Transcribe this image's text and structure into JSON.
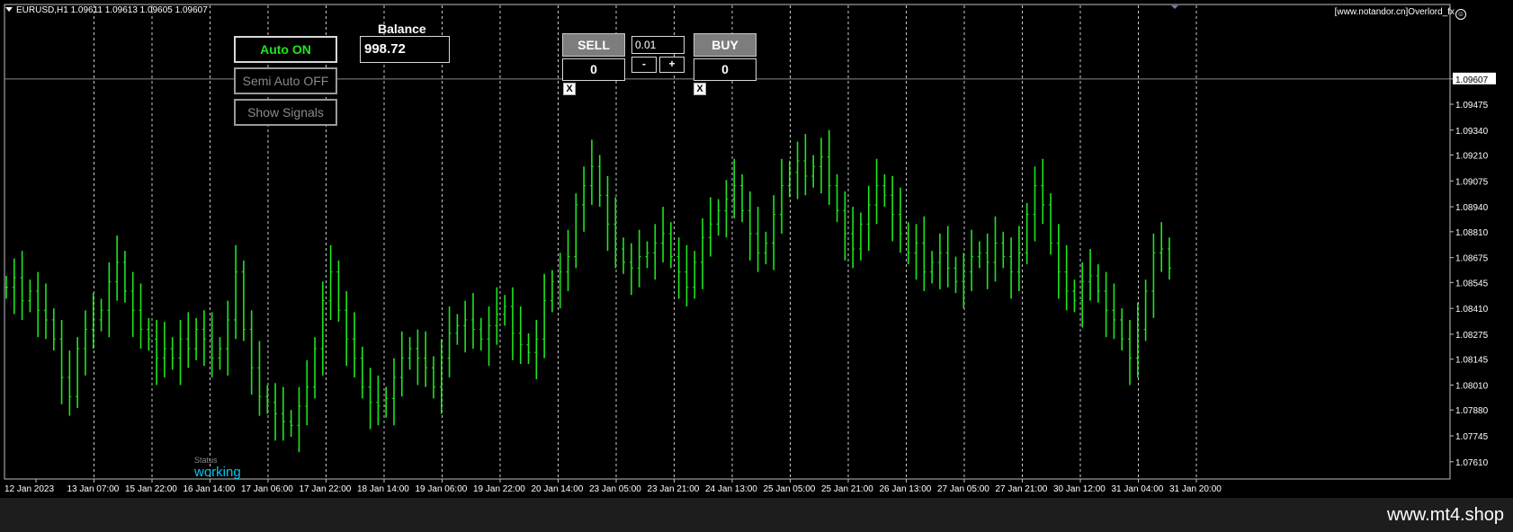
{
  "header": {
    "symbol_info": "EURUSD,H1  1.09611 1.09613 1.09605 1.09607",
    "brand": "[www.notandor.cn]Overlord_fx"
  },
  "panel": {
    "auto_label": "Auto ON",
    "semi_label": "Semi Auto OFF",
    "signals_label": "Show Signals",
    "balance_title": "Balance",
    "balance_value": "998.72"
  },
  "trade": {
    "sell_label": "SELL",
    "buy_label": "BUY",
    "lot_value": "0.01",
    "sell_count": "0",
    "buy_count": "0",
    "minus_label": "-",
    "plus_label": "+",
    "close_mark": "X"
  },
  "status": {
    "label": "Status",
    "value": "working"
  },
  "watermark": "www.mt4.shop",
  "colors": {
    "candles": "#1ee51e",
    "background": "#000000",
    "grid_vline": "#c8c8c8",
    "status": "#00c8f0"
  },
  "chart_data": {
    "type": "line",
    "symbol": "EURUSD",
    "timeframe": "H1",
    "current_price": "1.09607",
    "ylim": [
      1.0752,
      1.0985
    ],
    "y_ticks": [
      "1.09607",
      "1.09475",
      "1.09340",
      "1.09210",
      "1.09075",
      "1.08940",
      "1.08810",
      "1.08675",
      "1.08545",
      "1.08410",
      "1.08275",
      "1.08145",
      "1.08010",
      "1.07880",
      "1.07745",
      "1.07610"
    ],
    "x_tick_labels": [
      "12 Jan 2023",
      "13 Jan 07:00",
      "15 Jan 22:00",
      "16 Jan 14:00",
      "17 Jan 06:00",
      "17 Jan 22:00",
      "18 Jan 14:00",
      "19 Jan 06:00",
      "19 Jan 22:00",
      "20 Jan 14:00",
      "23 Jan 05:00",
      "23 Jan 21:00",
      "24 Jan 13:00",
      "25 Jan 05:00",
      "25 Jan 21:00",
      "26 Jan 13:00",
      "27 Jan 05:00",
      "27 Jan 21:00",
      "30 Jan 12:00",
      "31 Jan 04:00",
      "31 Jan 20:00"
    ],
    "vline_positions": [
      1,
      2,
      3,
      4,
      5,
      6,
      7,
      8,
      9,
      10,
      11,
      12,
      13,
      14,
      15,
      16,
      17,
      18,
      19,
      20
    ],
    "series": [
      {
        "values": [
          1.0852,
          1.0857,
          1.0845,
          1.085,
          1.084,
          1.0835,
          1.0825,
          1.0805,
          1.0795,
          1.082,
          1.083,
          1.0835,
          1.084,
          1.0855,
          1.0865,
          1.085,
          1.084,
          1.083,
          1.0825,
          1.0815,
          1.082,
          1.0815,
          1.0825,
          1.082,
          1.083,
          1.0825,
          1.0815,
          1.082,
          1.0835,
          1.086,
          1.083,
          1.081,
          1.0795,
          1.0792,
          1.0786,
          1.0782,
          1.078,
          1.079,
          1.08,
          1.082,
          1.0845,
          1.086,
          1.084,
          1.0825,
          1.0815,
          1.08,
          1.0792,
          1.079,
          1.0794,
          1.0805,
          1.0815,
          1.082,
          1.0815,
          1.081,
          1.08,
          1.0815,
          1.0828,
          1.0832,
          1.0835,
          1.083,
          1.0825,
          1.0832,
          1.0838,
          1.0842,
          1.0828,
          1.0822,
          1.0818,
          1.0825,
          1.0845,
          1.0855,
          1.086,
          1.0868,
          1.0895,
          1.0905,
          1.0915,
          1.09,
          1.0885,
          1.0872,
          1.0865,
          1.0862,
          1.0868,
          1.087,
          1.0875,
          1.088,
          1.0868,
          1.086,
          1.0852,
          1.0865,
          1.0878,
          1.0885,
          1.0892,
          1.0898,
          1.0905,
          1.0892,
          1.088,
          1.087,
          1.0875,
          1.089,
          1.0905,
          1.0912,
          1.0918,
          1.091,
          1.0915,
          1.092,
          1.0905,
          1.0892,
          1.088,
          1.0872,
          1.0885,
          1.0895,
          1.0905,
          1.09,
          1.089,
          1.088,
          1.087,
          1.0875,
          1.086,
          1.0865,
          1.087,
          1.0862,
          1.0855,
          1.086,
          1.0868,
          1.087,
          1.0865,
          1.0875,
          1.0868,
          1.086,
          1.087,
          1.089,
          1.0905,
          1.0895,
          1.0875,
          1.086,
          1.085,
          1.0845,
          1.0855,
          1.0858,
          1.085,
          1.084,
          1.0835,
          1.0825,
          1.0815,
          1.083,
          1.085,
          1.087,
          1.0872,
          1.0862
        ]
      }
    ]
  }
}
